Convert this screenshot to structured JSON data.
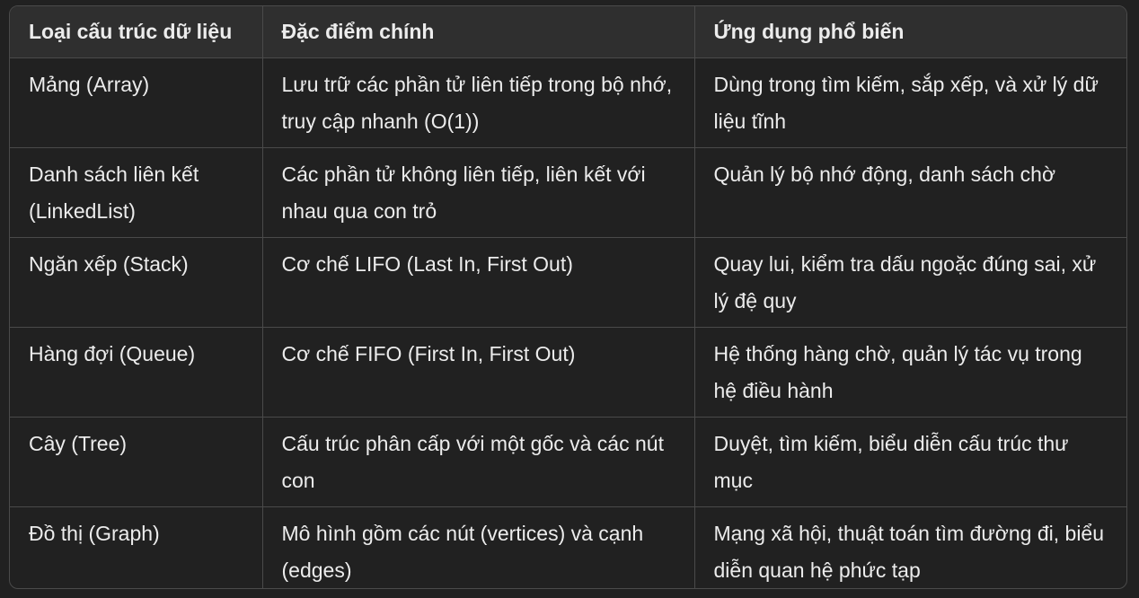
{
  "table": {
    "headers": [
      "Loại cấu trúc dữ liệu",
      "Đặc điểm chính",
      "Ứng dụng phổ biến"
    ],
    "rows": [
      {
        "type": "Mảng (Array)",
        "feature": "Lưu trữ các phần tử liên tiếp trong bộ nhớ, truy cập nhanh (O(1))",
        "usage": "Dùng trong tìm kiếm, sắp xếp, và xử lý dữ liệu tĩnh"
      },
      {
        "type": "Danh sách liên kết (LinkedList)",
        "feature": "Các phần tử không liên tiếp, liên kết với nhau qua con trỏ",
        "usage": "Quản lý bộ nhớ động, danh sách chờ"
      },
      {
        "type": "Ngăn xếp (Stack)",
        "feature": "Cơ chế LIFO (Last In, First Out)",
        "usage": "Quay lui, kiểm tra dấu ngoặc đúng sai, xử lý đệ quy"
      },
      {
        "type": "Hàng đợi (Queue)",
        "feature": "Cơ chế FIFO (First In, First Out)",
        "usage": "Hệ thống hàng chờ, quản lý tác vụ trong hệ điều hành"
      },
      {
        "type": "Cây (Tree)",
        "feature": "Cấu trúc phân cấp với một gốc và các nút con",
        "usage": "Duyệt, tìm kiếm, biểu diễn cấu trúc thư mục"
      },
      {
        "type": "Đồ thị (Graph)",
        "feature": "Mô hình gồm các nút (vertices) và cạnh (edges)",
        "usage": "Mạng xã hội, thuật toán tìm đường đi, biểu diễn quan hệ phức tạp"
      }
    ]
  },
  "colors": {
    "background": "#212121",
    "header_background": "#2f2f2f",
    "border": "#4a4a4a",
    "text": "#ececec"
  }
}
